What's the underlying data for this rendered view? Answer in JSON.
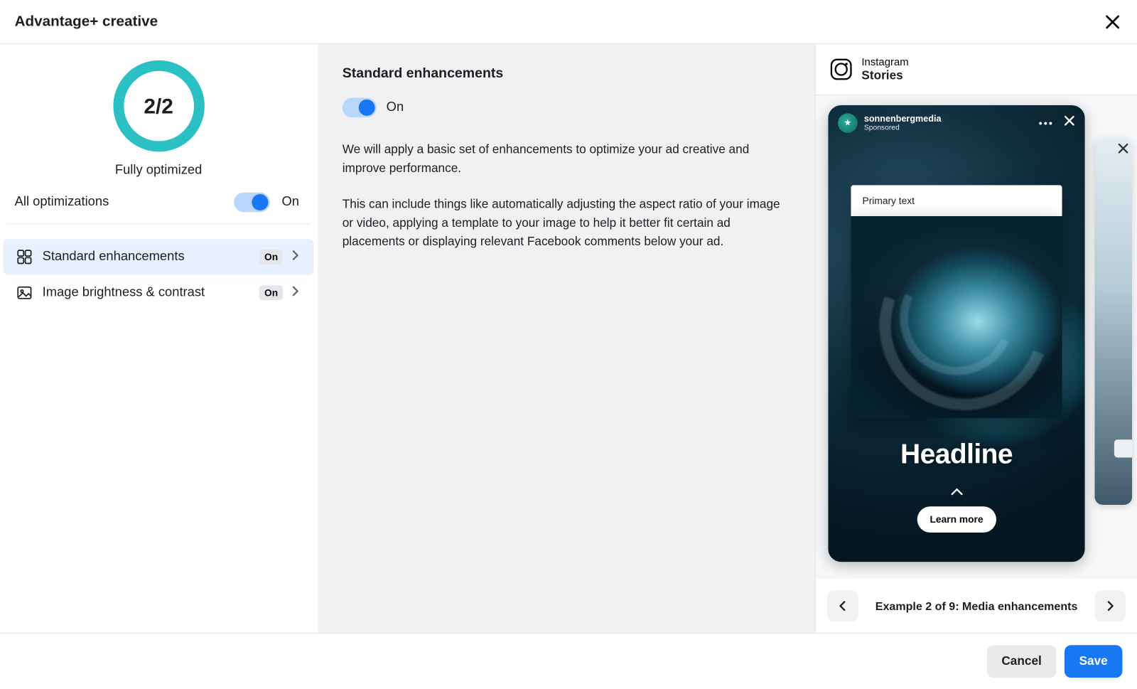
{
  "header": {
    "title": "Advantage+ creative"
  },
  "sidebar": {
    "gauge_value": "2/2",
    "gauge_label": "Fully optimized",
    "all_opt_label": "All optimizations",
    "all_opt_state": "On",
    "items": [
      {
        "label": "Standard enhancements",
        "state": "On"
      },
      {
        "label": "Image brightness & contrast",
        "state": "On"
      }
    ]
  },
  "detail": {
    "title": "Standard enhancements",
    "toggle_state": "On",
    "para1": "We will apply a basic set of enhancements to optimize your ad creative and improve performance.",
    "para2": "This can include things like automatically adjusting the aspect ratio of your image or video, applying a template to your image to help it better fit certain ad placements or displaying relevant Facebook comments below your ad."
  },
  "preview": {
    "platform": "Instagram",
    "placement": "Stories",
    "story": {
      "account": "sonnenbergmedia",
      "sponsored": "Sponsored",
      "primary_text": "Primary text",
      "headline": "Headline",
      "cta": "Learn more"
    },
    "nav_label": "Example 2 of 9: Media enhancements"
  },
  "footer": {
    "cancel": "Cancel",
    "save": "Save"
  }
}
